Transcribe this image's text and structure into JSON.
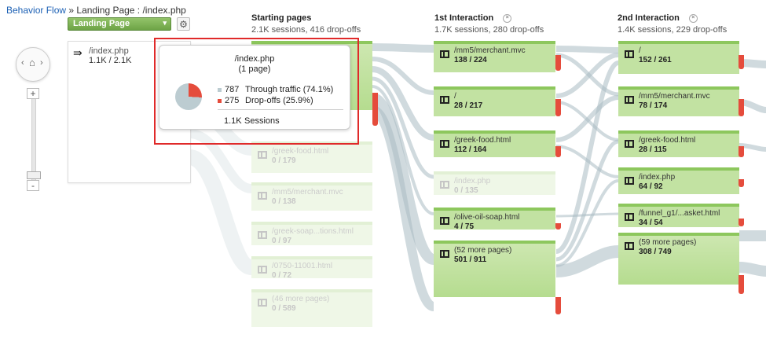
{
  "breadcrumb": {
    "root": "Behavior Flow",
    "sep": "»",
    "current": "Landing Page : /index.php"
  },
  "dimension_dropdown": {
    "value": "Landing Page",
    "caret": "▾"
  },
  "gear": "⚙",
  "nav": {
    "left": "‹",
    "home": "⌂",
    "right": "›"
  },
  "zoom": {
    "plus": "+",
    "minus": "-"
  },
  "landing": {
    "arrow": "⇛",
    "title": "/index.php",
    "stats": "1.1K / 2.1K"
  },
  "columns": [
    {
      "title": "Starting pages",
      "sub": "2.1K sessions, 416 drop-offs"
    },
    {
      "title": "1st Interaction",
      "sub": "1.7K sessions, 280 drop-offs",
      "close": "×"
    },
    {
      "title": "2nd Interaction",
      "sub": "1.4K sessions, 229 drop-offs",
      "close": "×"
    }
  ],
  "starting_nodes": [
    {
      "name": "/greek-food.html",
      "count": "0 / 179"
    },
    {
      "name": "/mm5/merchant.mvc",
      "count": "0 / 138"
    },
    {
      "name": "/greek-soap...tions.html",
      "count": "0 / 97"
    },
    {
      "name": "/0750-11001.html",
      "count": "0 / 72"
    },
    {
      "name": "(46 more pages)",
      "count": "0 / 589"
    }
  ],
  "first_interaction": [
    {
      "name": "/mm5/merchant.mvc",
      "count": "138 / 224"
    },
    {
      "name": "/",
      "count": "28 / 217"
    },
    {
      "name": "/greek-food.html",
      "count": "112 / 164"
    },
    {
      "name": "/index.php",
      "count": "0 / 135"
    },
    {
      "name": "/olive-oil-soap.html",
      "count": "4 / 75"
    },
    {
      "name": "(52 more pages)",
      "count": "501 / 911"
    }
  ],
  "second_interaction": [
    {
      "name": "/",
      "count": "152 / 261"
    },
    {
      "name": "/mm5/merchant.mvc",
      "count": "78 / 174"
    },
    {
      "name": "/greek-food.html",
      "count": "28 / 115"
    },
    {
      "name": "/index.php",
      "count": "64 / 92"
    },
    {
      "name": "/funnel_g1/...asket.html",
      "count": "34 / 54"
    },
    {
      "name": "(59 more pages)",
      "count": "308 / 749"
    }
  ],
  "tooltip": {
    "title": "/index.php",
    "subtitle": "(1 page)",
    "through_value": "787",
    "through_label": "Through traffic (74.1%)",
    "drop_value": "275",
    "drop_label": "Drop-offs (25.9%)",
    "sessions_value": "1.1K",
    "sessions_label": "Sessions",
    "through_share": 0.741,
    "drop_share": 0.259
  },
  "colors": {
    "node_green": "#c2e2a2",
    "node_top": "#8dc75d",
    "dropoff_red": "#e54c3c",
    "through_grey": "#bcccd1",
    "link_grey": "#9aaeb6",
    "highlight_box": "#e02a2a"
  }
}
